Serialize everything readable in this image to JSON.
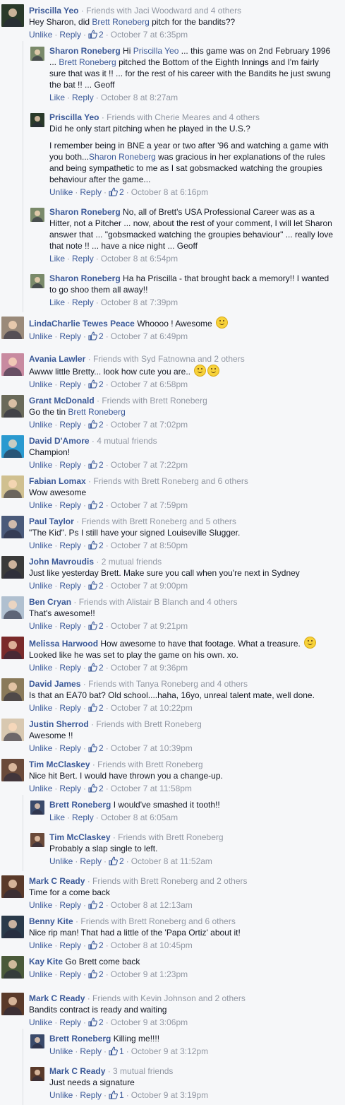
{
  "labels": {
    "unlike": "Unlike",
    "like": "Like",
    "reply": "Reply"
  },
  "comments": [
    {
      "id": "c1",
      "level": 0,
      "name": "Priscilla Yeo",
      "meta": "· Friends with Jaci Woodward and 4 others",
      "segments": [
        {
          "t": "Hey Sharon, did "
        },
        {
          "t": "Brett Roneberg",
          "mention": true
        },
        {
          "t": " pitch for the bandits??"
        }
      ],
      "action": "unlike",
      "likes": "2",
      "time": "October 7 at 6:35pm",
      "avatar": "#2a3a2a"
    },
    {
      "id": "c2",
      "level": 1,
      "name": "Sharon Roneberg",
      "meta": "",
      "segments": [
        {
          "t": "Hi "
        },
        {
          "t": "Priscilla Yeo",
          "mention": true
        },
        {
          "t": " ... this game was on 2nd February 1996 ... "
        },
        {
          "t": "Brett Roneberg",
          "mention": true
        },
        {
          "t": " pitched the Bottom of the Eighth Innings and I'm fairly sure that was it !! ... for the rest of his career with the Bandits he just swung the bat !! ... Geoff"
        }
      ],
      "action": "like",
      "likes": "",
      "time": "October 8 at 8:27am",
      "avatar": "#7a8a6a"
    },
    {
      "id": "c3",
      "level": 1,
      "name": "Priscilla Yeo",
      "meta": "· Friends with Cherie Meares and 4 others",
      "segments": [
        {
          "t": "Did he only start pitching when he played in the U.S.?"
        },
        {
          "br": true
        },
        {
          "t": "I remember being in BNE a year or two after '96 and watching a game with you both..."
        },
        {
          "t": "Sharon Roneberg",
          "mention": true
        },
        {
          "t": " was gracious in her explanations of the rules and being sympathetic to me as I sat gobsmacked watching the groupies behaviour after the game..."
        }
      ],
      "action": "unlike",
      "likes": "2",
      "time": "October 8 at 6:16pm",
      "avatar": "#2a3a2a"
    },
    {
      "id": "c4",
      "level": 1,
      "name": "Sharon Roneberg",
      "meta": "",
      "segments": [
        {
          "t": "No, all of Brett's USA Professional Career was as a Hitter, not a Pitcher ... now, about the rest of your comment, I will let Sharon answer that ... \"gobsmacked watching the groupies behaviour\" ... really love that note !! ... have a nice night ... Geoff"
        }
      ],
      "action": "like",
      "likes": "",
      "time": "October 8 at 6:54pm",
      "avatar": "#7a8a6a"
    },
    {
      "id": "c5",
      "level": 1,
      "name": "Sharon Roneberg",
      "meta": "",
      "segments": [
        {
          "t": "Ha ha Priscilla - that brought back a memory!! I wanted to go shoo them all away!!"
        }
      ],
      "action": "like",
      "likes": "",
      "time": "October 8 at 7:39pm",
      "avatar": "#7a8a6a"
    },
    {
      "id": "c6",
      "level": 0,
      "name": "LindaCharlie Tewes Peace",
      "meta": "",
      "segments": [
        {
          "t": "Whoooo ! Awesome "
        },
        {
          "emoji": "wink"
        }
      ],
      "action": "unlike",
      "likes": "2",
      "time": "October 7 at 6:49pm",
      "avatar": "#9a8a7a"
    },
    {
      "id": "c7",
      "level": 0,
      "name": "Avania Lawler",
      "meta": "· Friends with Syd Fatnowna and 2 others",
      "segments": [
        {
          "t": "Awww little Bretty... look how cute you are.. "
        },
        {
          "emoji": "grin"
        },
        {
          "emoji": "wink"
        }
      ],
      "action": "unlike",
      "likes": "2",
      "time": "October 7 at 6:58pm",
      "avatar": "#c88aa0"
    },
    {
      "id": "c8",
      "level": 0,
      "name": "Grant McDonald",
      "meta": "· Friends with Brett Roneberg",
      "segments": [
        {
          "t": "Go the tin "
        },
        {
          "t": "Brett Roneberg",
          "mention": true
        }
      ],
      "action": "unlike",
      "likes": "2",
      "time": "October 7 at 7:02pm",
      "avatar": "#6a6a5a"
    },
    {
      "id": "c9",
      "level": 0,
      "name": "David D'Amore",
      "meta": "· 4 mutual friends",
      "segments": [
        {
          "t": "Champion!"
        }
      ],
      "action": "unlike",
      "likes": "2",
      "time": "October 7 at 7:22pm",
      "avatar": "#2a9ad0"
    },
    {
      "id": "c10",
      "level": 0,
      "name": "Fabian Lomax",
      "meta": "· Friends with Brett Roneberg and 6 others",
      "segments": [
        {
          "t": "Wow awesome"
        }
      ],
      "action": "unlike",
      "likes": "2",
      "time": "October 7 at 7:59pm",
      "avatar": "#d0c090"
    },
    {
      "id": "c11",
      "level": 0,
      "name": "Paul Taylor",
      "meta": "· Friends with Brett Roneberg and 5 others",
      "segments": [
        {
          "t": "\"The Kid\". Ps I still have your signed Louiseville Slugger."
        }
      ],
      "action": "unlike",
      "likes": "2",
      "time": "October 7 at 8:50pm",
      "avatar": "#4a5a7a"
    },
    {
      "id": "c12",
      "level": 0,
      "name": "John Mavroudis",
      "meta": "· 2 mutual friends",
      "segments": [
        {
          "t": "Just like yesterday Brett. Make sure you call when you're next in Sydney"
        }
      ],
      "action": "unlike",
      "likes": "2",
      "time": "October 7 at 9:00pm",
      "avatar": "#3a3a3a"
    },
    {
      "id": "c13",
      "level": 0,
      "name": "Ben Cryan",
      "meta": "· Friends with Alistair B Blanch and 4 others",
      "segments": [
        {
          "t": "That's awesome!!"
        }
      ],
      "action": "unlike",
      "likes": "2",
      "time": "October 7 at 9:21pm",
      "avatar": "#b0c0d0"
    },
    {
      "id": "c14",
      "level": 0,
      "name": "Melissa Harwood",
      "meta": "",
      "segments": [
        {
          "t": "How awesome to have that footage. What a treasure. "
        },
        {
          "emoji": "smile"
        },
        {
          "t": " Looked like he was set to play the game on his own. xo."
        }
      ],
      "action": "unlike",
      "likes": "2",
      "time": "October 7 at 9:36pm",
      "avatar": "#7a2a2a"
    },
    {
      "id": "c15",
      "level": 0,
      "name": "David James",
      "meta": "· Friends with Tanya Roneberg and 4 others",
      "segments": [
        {
          "t": "Is that an EA70 bat? Old school....haha, 16yo, unreal talent mate, well done."
        }
      ],
      "action": "unlike",
      "likes": "2",
      "time": "October 7 at 10:22pm",
      "avatar": "#8a7a5a"
    },
    {
      "id": "c16",
      "level": 0,
      "name": "Justin Sherrod",
      "meta": "· Friends with Brett Roneberg",
      "segments": [
        {
          "t": "Awesome !!"
        }
      ],
      "action": "unlike",
      "likes": "2",
      "time": "October 7 at 10:39pm",
      "avatar": "#d8c8b0"
    },
    {
      "id": "c17",
      "level": 0,
      "name": "Tim McClaskey",
      "meta": "· Friends with Brett Roneberg",
      "segments": [
        {
          "t": "Nice hit Bert. I would have thrown you a change-up."
        }
      ],
      "action": "unlike",
      "likes": "2",
      "time": "October 7 at 11:58pm",
      "avatar": "#6a4a3a"
    },
    {
      "id": "c18",
      "level": 1,
      "name": "Brett Roneberg",
      "meta": "",
      "segments": [
        {
          "t": "I would've smashed it tooth!!"
        }
      ],
      "action": "like",
      "likes": "",
      "time": "October 8 at 6:05am",
      "avatar": "#3a4a6a"
    },
    {
      "id": "c19",
      "level": 1,
      "name": "Tim McClaskey",
      "meta": "· Friends with Brett Roneberg",
      "segments": [
        {
          "t": "Probably a slap single to left."
        }
      ],
      "action": "unlike",
      "likes": "2",
      "time": "October 8 at 11:52am",
      "avatar": "#6a4a3a"
    },
    {
      "id": "c20",
      "level": 0,
      "name": "Mark C Ready",
      "meta": "· Friends with Brett Roneberg and 2 others",
      "segments": [
        {
          "t": "Time for a come back"
        }
      ],
      "action": "unlike",
      "likes": "2",
      "time": "October 8 at 12:13am",
      "avatar": "#5a3a2a"
    },
    {
      "id": "c21",
      "level": 0,
      "name": "Benny Kite",
      "meta": "· Friends with Brett Roneberg and 6 others",
      "segments": [
        {
          "t": "Nice rip man! That had a little of the 'Papa Ortiz' about it!"
        }
      ],
      "action": "unlike",
      "likes": "2",
      "time": "October 8 at 10:45pm",
      "avatar": "#2a3a4a"
    },
    {
      "id": "c22",
      "level": 0,
      "name": "Kay Kite",
      "meta": "",
      "segments": [
        {
          "t": "Go Brett come back"
        }
      ],
      "action": "unlike",
      "likes": "2",
      "time": "October 9 at 1:23pm",
      "avatar": "#4a5a3a"
    },
    {
      "id": "c23",
      "level": 0,
      "name": "Mark C Ready",
      "meta": "· Friends with Kevin Johnson and 2 others",
      "segments": [
        {
          "t": "Bandits contract is ready and waiting"
        }
      ],
      "action": "unlike",
      "likes": "2",
      "time": "October 9 at 3:06pm",
      "avatar": "#5a3a2a"
    },
    {
      "id": "c24",
      "level": 1,
      "name": "Brett Roneberg",
      "meta": "",
      "segments": [
        {
          "t": "Killing me!!!!"
        }
      ],
      "action": "unlike",
      "likes": "1",
      "time": "October 9 at 3:12pm",
      "avatar": "#3a4a6a"
    },
    {
      "id": "c25",
      "level": 1,
      "name": "Mark C Ready",
      "meta": "· 3 mutual friends",
      "segments": [
        {
          "t": "Just needs a signature"
        }
      ],
      "action": "unlike",
      "likes": "1",
      "time": "October 9 at 3:19pm",
      "avatar": "#5a3a2a"
    }
  ]
}
